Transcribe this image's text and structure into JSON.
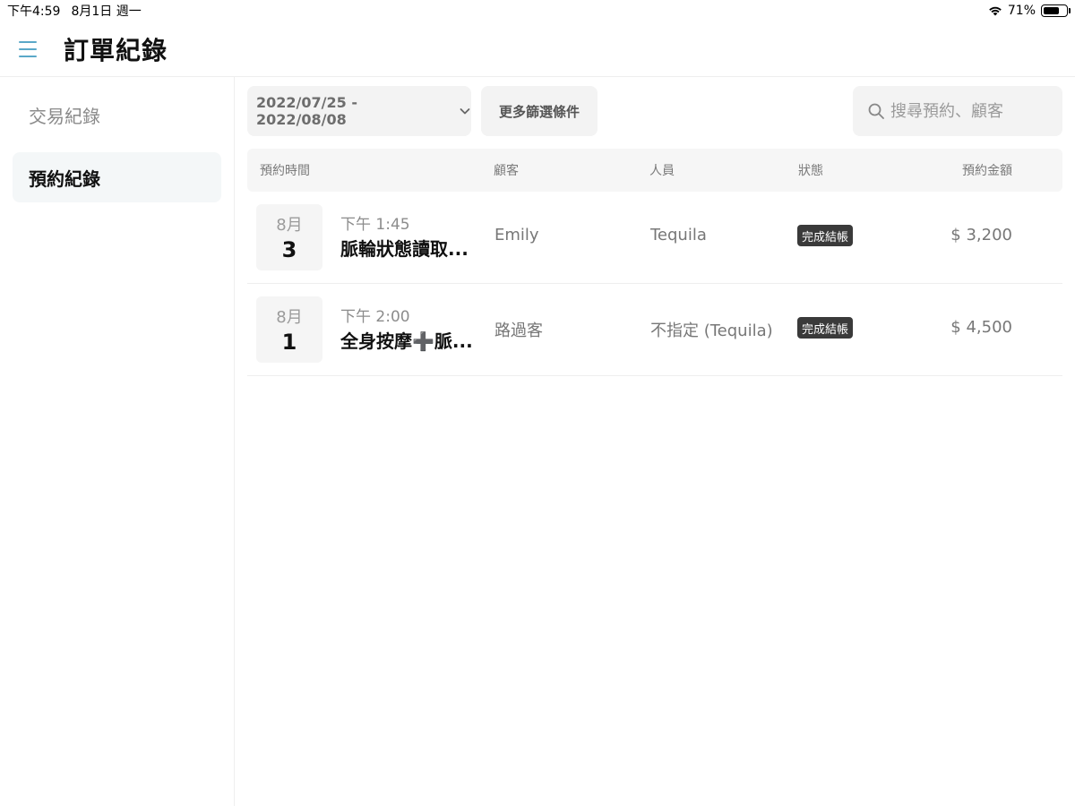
{
  "status_bar": {
    "time": "下午4:59",
    "date": "8月1日 週一",
    "battery_text": "71%",
    "battery_level": 0.71
  },
  "header": {
    "title": "訂單紀錄",
    "menu_icon": "menu-icon"
  },
  "sidebar": {
    "items": [
      {
        "label": "交易紀錄",
        "active": false
      },
      {
        "label": "預約紀錄",
        "active": true
      }
    ]
  },
  "toolbar": {
    "date_range": "2022/07/25 - 2022/08/08",
    "filter_label": "更多篩選條件",
    "search_placeholder": "搜尋預約、顧客"
  },
  "table": {
    "headers": {
      "time": "預約時間",
      "customer": "顧客",
      "staff": "人員",
      "status": "狀態",
      "amount": "預約金額"
    },
    "rows": [
      {
        "month": "8月",
        "day": "3",
        "time": "下午 1:45",
        "service": "脈輪狀態讀取...",
        "customer": "Emily",
        "staff": "Tequila",
        "status": "完成結帳",
        "amount": "$ 3,200"
      },
      {
        "month": "8月",
        "day": "1",
        "time": "下午 2:00",
        "service": "全身按摩➕脈...",
        "customer": "路過客",
        "staff": "不指定 (Tequila)",
        "status": "完成結帳",
        "amount": "$ 4,500"
      }
    ]
  },
  "colors": {
    "accent": "#5aa8c8",
    "status_badge": "#3a3a3a"
  }
}
